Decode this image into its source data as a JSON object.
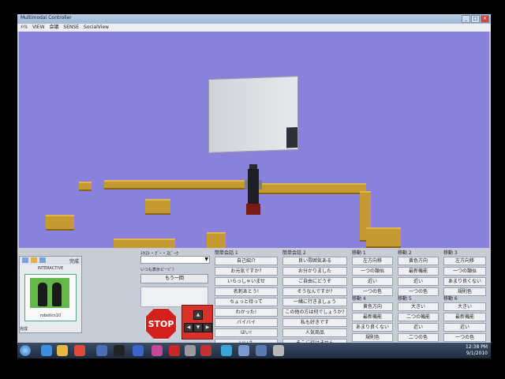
{
  "window": {
    "title": "Multimodal Controller",
    "menu": [
      "ﾒｲﾙ",
      "VIEW",
      "会議",
      "SENSE",
      "SocialView"
    ]
  },
  "file_panel": {
    "label": "INTERACTIVE",
    "toolbar_label": "完成",
    "thumb_caption": "robotics10",
    "footer": "完成"
  },
  "text_input": {
    "title": "ﾃｷｽﾄ・ｸﾞｰ・ｽﾋﾟｰｸ",
    "hint": "いつも表示ピーﾋﾟﾌ",
    "repeat_button": "もう一回"
  },
  "stop_button": "STOP",
  "groups": [
    {
      "title": "簡単会話 1",
      "buttons": [
        "自己紹介",
        "お元気ですか?",
        "いらっしゃいませ",
        "名刺あとう!",
        "ちょっと待って",
        "わかった!",
        "バイバイ",
        "はい!",
        "いいえ"
      ]
    },
    {
      "title": "簡単会話 2",
      "buttons": [
        "良い雰囲気ある",
        "お分かりました",
        "ご自由にどうぞ",
        "そうなんですか?",
        "一緒に行きましょう",
        "この他の方は何でしょうか?",
        "私も好きです",
        "人気商品",
        "そこに行けません"
      ]
    },
    {
      "title": "移動 1",
      "buttons": [
        "左方向移",
        "一つの類似",
        "近い",
        "一つの色"
      ]
    },
    {
      "title": "移動 2",
      "buttons": [
        "黄色方向",
        "最新機能",
        "近い",
        "一つの色"
      ]
    },
    {
      "title": "移動 3",
      "buttons": [
        "左方向移",
        "一つの類似",
        "あまり良くない",
        "規則色"
      ]
    },
    {
      "title": "移動 4",
      "buttons": [
        "黄色方向",
        "最新機能",
        "あまり良くない",
        "規則色"
      ]
    },
    {
      "title": "移動 5",
      "buttons": [
        "大きい",
        "二つの機能",
        "近い",
        "二つの色"
      ]
    },
    {
      "title": "移動 6",
      "buttons": [
        "大きい",
        "最新機能",
        "近い",
        "一つの色"
      ]
    }
  ],
  "taskbar": {
    "time": "12:38 PM",
    "date": "9/1/2010"
  }
}
